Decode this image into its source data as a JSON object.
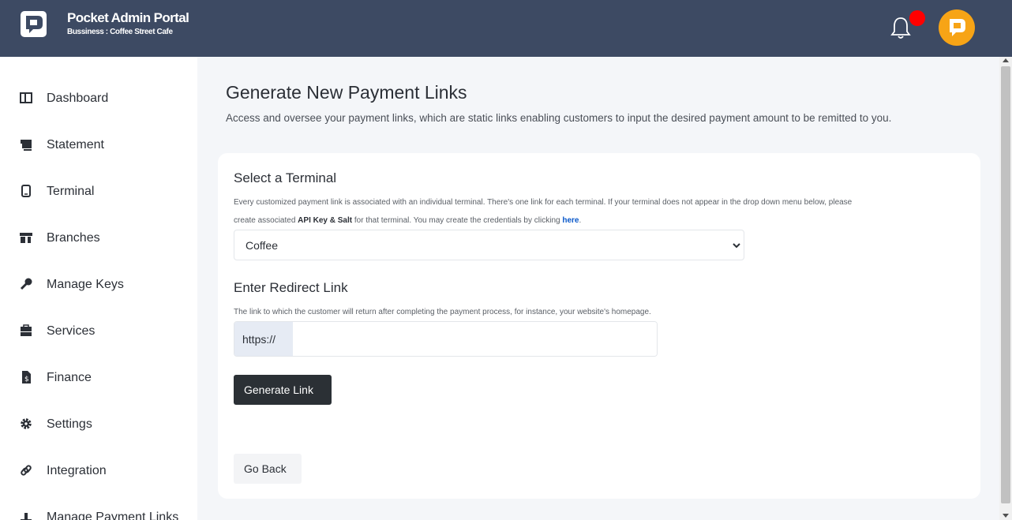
{
  "header": {
    "title": "Pocket Admin Portal",
    "subtitle": "Bussiness : Coffee Street Cafe",
    "logo_icon": "pocket-logo-icon",
    "notification_icon": "bell-icon",
    "avatar_icon": "pocket-avatar-icon",
    "colors": {
      "topbar": "#3d4a63",
      "badge": "#ff0000",
      "avatar": "#f7a416"
    }
  },
  "sidebar": {
    "items": [
      {
        "label": "Dashboard",
        "icon": "dashboard-icon"
      },
      {
        "label": "Statement",
        "icon": "statement-icon"
      },
      {
        "label": "Terminal",
        "icon": "terminal-icon"
      },
      {
        "label": "Branches",
        "icon": "store-icon"
      },
      {
        "label": "Manage Keys",
        "icon": "key-icon"
      },
      {
        "label": "Services",
        "icon": "toolbox-icon"
      },
      {
        "label": "Finance",
        "icon": "finance-icon"
      },
      {
        "label": "Settings",
        "icon": "gear-icon"
      },
      {
        "label": "Integration",
        "icon": "link-icon"
      },
      {
        "label": "Manage Payment Links",
        "icon": "payment-links-icon"
      }
    ]
  },
  "main": {
    "title": "Generate New Payment Links",
    "description": "Access and oversee your payment links, which are static links enabling customers to input the desired payment amount to be remitted to you.",
    "terminal": {
      "heading": "Select a Terminal",
      "help_line1": "Every customized payment link is associated with an individual terminal. There's one link for each terminal. If your terminal does not appear in the drop down menu below, please",
      "help_line2_before": "create associated",
      "help_line2_bold": "API Key & Salt",
      "help_line2_middle": "for that terminal. You may create the credentials by clicking",
      "help_line2_link": "here",
      "help_line2_end": ".",
      "selected": "Coffee"
    },
    "redirect": {
      "heading": "Enter Redirect Link",
      "help": "The link to which the customer will return after completing the payment process, for instance, your website's homepage.",
      "prefix": "https://",
      "value": ""
    },
    "generate_label": "Generate Link",
    "back_label": "Go Back"
  }
}
